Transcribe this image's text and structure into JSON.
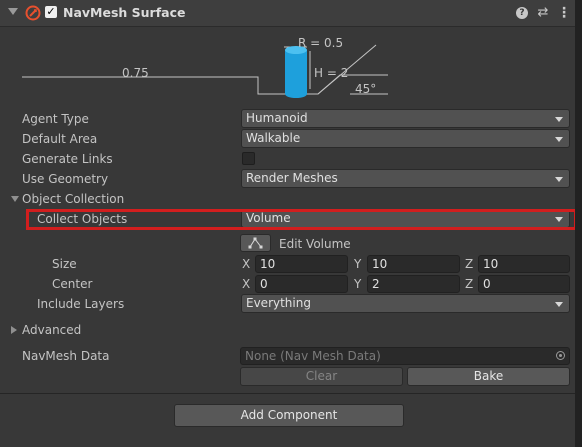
{
  "component": {
    "title": "NavMesh Surface",
    "enabled": true,
    "icons": {
      "foldout": "chevron-down-icon",
      "component": "navmesh-surface-icon",
      "help": "help-icon",
      "preset": "preset-icon",
      "menu": "kebab-menu-icon"
    }
  },
  "diagram": {
    "radius_label": "R = 0.5",
    "height_label": "H = 2",
    "step_label": "0.75",
    "slope_label": "45°",
    "agent_color": "#1ea0dc"
  },
  "properties": {
    "agent_type": {
      "label": "Agent Type",
      "value": "Humanoid"
    },
    "default_area": {
      "label": "Default Area",
      "value": "Walkable"
    },
    "generate_links": {
      "label": "Generate Links",
      "checked": false
    },
    "use_geometry": {
      "label": "Use Geometry",
      "value": "Render Meshes"
    },
    "object_collection": {
      "label": "Object Collection",
      "collect_objects": {
        "label": "Collect Objects",
        "value": "Volume"
      },
      "edit_volume": {
        "label": "Edit Volume"
      },
      "size": {
        "label": "Size",
        "x_label": "X",
        "y_label": "Y",
        "z_label": "Z",
        "x": "10",
        "y": "10",
        "z": "10"
      },
      "center": {
        "label": "Center",
        "x_label": "X",
        "y_label": "Y",
        "z_label": "Z",
        "x": "0",
        "y": "2",
        "z": "0"
      },
      "include_layers": {
        "label": "Include Layers",
        "value": "Everything"
      }
    },
    "advanced": {
      "label": "Advanced"
    },
    "navmesh_data": {
      "label": "NavMesh Data",
      "value": "None (Nav Mesh Data)"
    }
  },
  "buttons": {
    "clear": "Clear",
    "bake": "Bake",
    "add_component": "Add Component"
  },
  "highlight_color": "#d21e1e"
}
